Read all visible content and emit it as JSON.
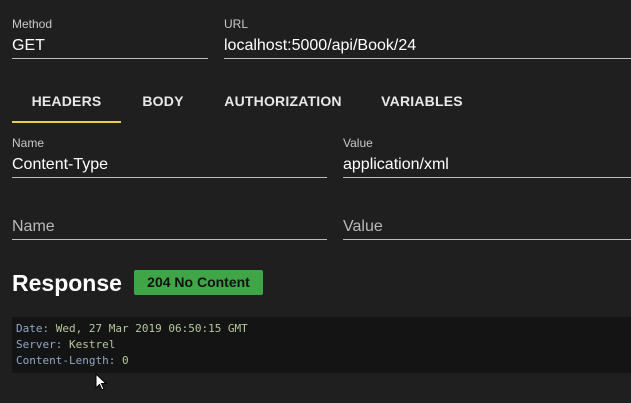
{
  "request": {
    "method": {
      "label": "Method",
      "value": "GET"
    },
    "url": {
      "label": "URL",
      "value": "localhost:5000/api/Book/24"
    }
  },
  "tabs": [
    {
      "label": "HEADERS",
      "active": true
    },
    {
      "label": "BODY",
      "active": false
    },
    {
      "label": "AUTHORIZATION",
      "active": false
    },
    {
      "label": "VARIABLES",
      "active": false
    }
  ],
  "headers": {
    "row1": {
      "name_label": "Name",
      "name_value": "Content-Type",
      "value_label": "Value",
      "value_value": "application/xml"
    },
    "row2": {
      "name_placeholder": "Name",
      "value_placeholder": "Value"
    }
  },
  "response": {
    "title": "Response",
    "status": "204 No Content",
    "status_color": "#3fa547",
    "headers": [
      {
        "key": "Date",
        "value": "Wed, 27 Mar 2019 06:50:15 GMT"
      },
      {
        "key": "Server",
        "value": "Kestrel"
      },
      {
        "key": "Content-Length",
        "value": "0"
      }
    ]
  },
  "colors": {
    "background": "#1f1f1f",
    "accent": "#f2c94c",
    "code_background": "#141414"
  },
  "icons": {
    "cursor": "mouse-pointer-icon"
  }
}
